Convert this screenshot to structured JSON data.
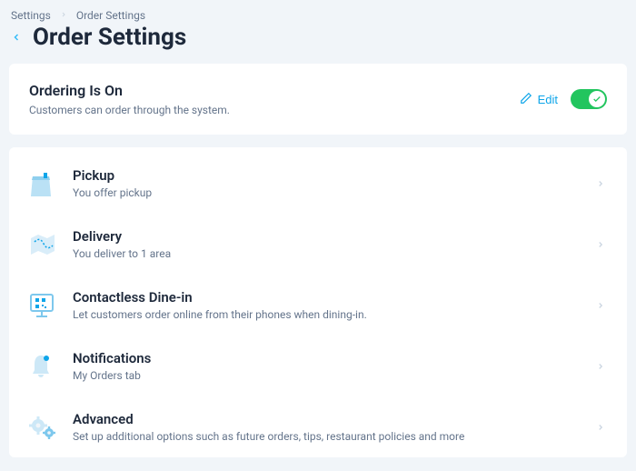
{
  "breadcrumb": {
    "root": "Settings",
    "current": "Order Settings"
  },
  "page_title": "Order Settings",
  "status": {
    "title": "Ordering Is On",
    "description": "Customers can order through the system.",
    "edit_label": "Edit",
    "toggle_on": true
  },
  "sections": [
    {
      "id": "pickup",
      "title": "Pickup",
      "description": "You offer pickup"
    },
    {
      "id": "delivery",
      "title": "Delivery",
      "description": "You deliver to 1 area"
    },
    {
      "id": "dinein",
      "title": "Contactless Dine-in",
      "description": "Let customers order online from their phones when dining-in."
    },
    {
      "id": "notifications",
      "title": "Notifications",
      "description": "My Orders tab"
    },
    {
      "id": "advanced",
      "title": "Advanced",
      "description": "Set up additional options such as future orders, tips, restaurant policies and more"
    }
  ]
}
